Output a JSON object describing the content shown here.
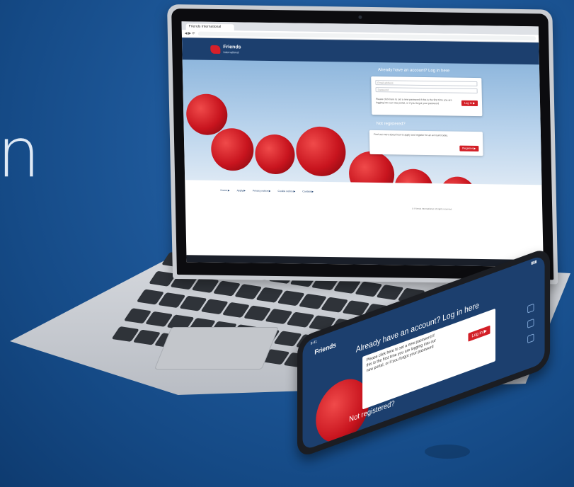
{
  "hero": {
    "glyph": "n"
  },
  "browser": {
    "tab_title": "Friends International"
  },
  "site": {
    "logo_name": "Friends",
    "logo_sub": "International",
    "login_heading": "Already have an account? Log in here",
    "email_placeholder": "Email address",
    "password_placeholder": "Password",
    "login_note": "Please click here to set a new password if this is the first time you are logging into our new portal, or if you forgot your password",
    "login_button": "Log in ▶",
    "register_heading": "Not registered?",
    "register_note": "Find out more about how to apply and register for an account today.",
    "register_button": "Register ▶",
    "footer_links": [
      "Home ▶",
      "Apply ▶",
      "Privacy notice ▶",
      "Cookie notice ▶",
      "Contact ▶"
    ],
    "copyright": "© Friends International. All rights reserved."
  },
  "phone": {
    "status_time": "9:41",
    "logo_name": "Friends",
    "login_heading": "Already have an account? Log in here",
    "login_note": "Please click here to set a new password if this is the first time you are logging into our new portal, or if you forgot your password",
    "login_button": "Log in ▶",
    "register_heading": "Not registered?"
  },
  "colors": {
    "brand_navy": "#1c3f6e",
    "brand_red": "#d31f27",
    "background": "#1f5a9c"
  }
}
